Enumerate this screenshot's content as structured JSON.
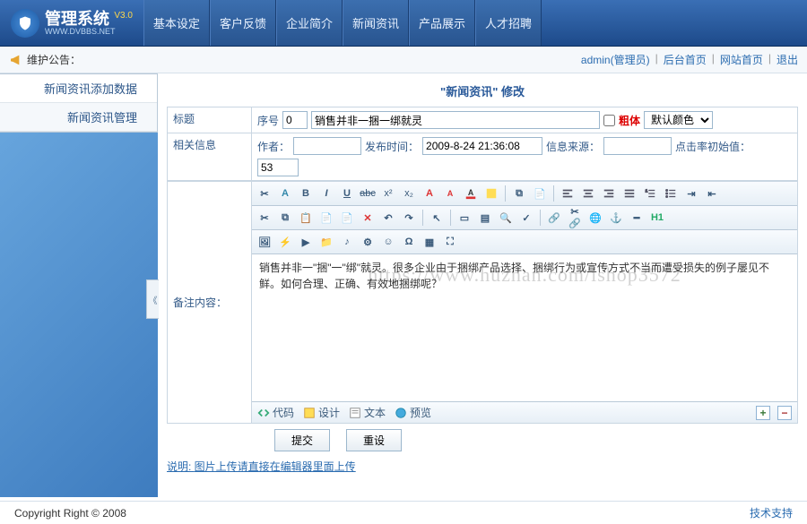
{
  "brand": {
    "title": "管理系统",
    "version": "V3.0",
    "subtitle": "WWW.DVBBS.NET"
  },
  "top_nav": [
    "基本设定",
    "客户反馈",
    "企业简介",
    "新闻资讯",
    "产品展示",
    "人才招聘"
  ],
  "notice": {
    "label": "维护公告："
  },
  "header_links": {
    "user": "admin(管理员)",
    "home": "后台首页",
    "site": "网站首页",
    "logout": "退出"
  },
  "side_menu": [
    "新闻资讯添加数据",
    "新闻资讯管理"
  ],
  "page": {
    "title_prefix": "\"",
    "title_category": "新闻资讯",
    "title_suffix": "\" 修改",
    "row_title_label": "标题",
    "seq_label": "序号",
    "seq_value": "0",
    "title_value": "销售并非一捆一绑就灵",
    "bold_label": "粗体",
    "font_select": "默认颜色",
    "row_related_label": "相关信息",
    "author_label": "作者：",
    "author_value": "",
    "date_label": "发布时间：",
    "date_value": "2009-8-24 21:36:08",
    "source_label": "信息来源：",
    "source_value": "",
    "hits_label": "点击率初始值：",
    "hits_value": "53",
    "row_content_label": "备注内容：",
    "editor_text": "销售并非一\"捆\"一\"绑\"就灵。很多企业由于捆绑产品选择、捆绑行为或宣传方式不当而遭受损失的例子屡见不鲜。如何合理、正确、有效地捆绑呢？",
    "watermark": "https://www.huzhan.com/ishop3572",
    "tab_code": "代码",
    "tab_design": "设计",
    "tab_text": "文本",
    "tab_preview": "预览",
    "btn_submit": "提交",
    "btn_reset": "重设",
    "note_label": "说明: ",
    "note_link": "图片上传请直接在编辑器里面上传"
  },
  "footer": {
    "left": "Copyright Right © 2008",
    "right": "技术支持"
  },
  "icons": {
    "cut": "✂",
    "copy": "⧉",
    "paste": "📋",
    "undo": "↶",
    "redo": "↷",
    "find": "🔍",
    "bold": "B",
    "italic": "I",
    "underline": "U",
    "strike": "abc",
    "super": "x²",
    "sub": "x₂",
    "font_inc": "A",
    "font_dec": "A",
    "clean": "✕",
    "color": "A",
    "bg": "A",
    "left": "≡",
    "center": "≡",
    "right": "≡",
    "justify": "≡",
    "olist": "≣",
    "ulist": "≣",
    "indent": "⇥",
    "outdent": "⇤",
    "link": "🔗",
    "image": "🖼",
    "table": "▦",
    "media": "▶",
    "anchor": "⚓",
    "hr": "—",
    "emoji": "☺",
    "full": "⛶",
    "help": "H1"
  }
}
